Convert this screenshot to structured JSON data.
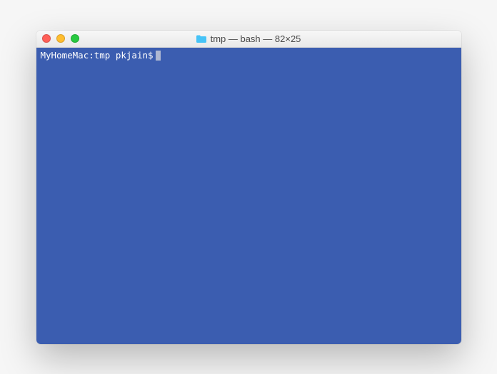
{
  "window": {
    "title": "tmp — bash — 82×25",
    "icon": "folder-icon"
  },
  "terminal": {
    "prompt": "MyHomeMac:tmp pkjain$",
    "background": "#3b5db0",
    "foreground": "#ffffff"
  }
}
